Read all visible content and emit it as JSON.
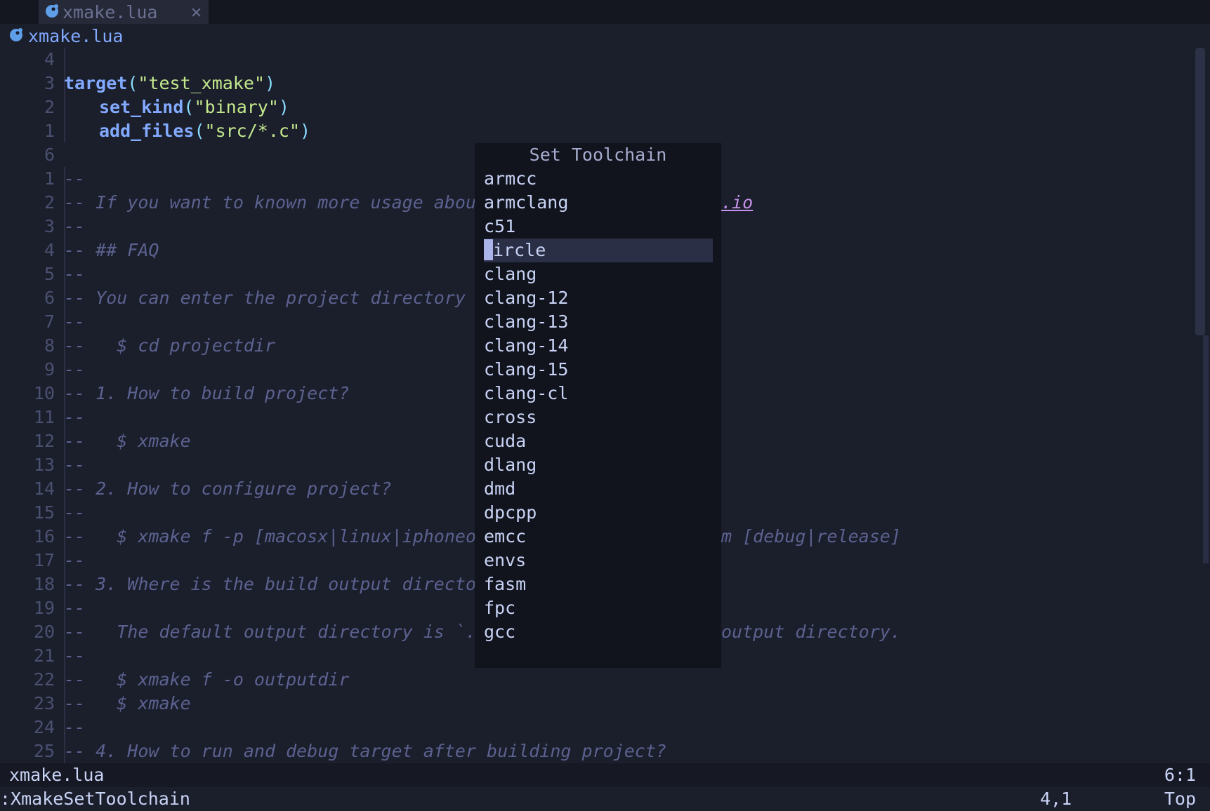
{
  "tabline": {
    "tab_label": "xmake.lua",
    "close_glyph": "✕"
  },
  "winbar": {
    "filename": "xmake.lua"
  },
  "code_lines": [
    {
      "num": "4",
      "text": ""
    },
    {
      "num": "3",
      "target": "target",
      "arg": "\"test_xmake\""
    },
    {
      "num": "2",
      "fn": "set_kind",
      "arg": "\"binary\""
    },
    {
      "num": "1",
      "fn": "add_files",
      "arg": "\"src/*.c\""
    },
    {
      "num": "6",
      "text": ""
    },
    {
      "num": "1",
      "comment": "--"
    },
    {
      "num": "2",
      "comment": "-- If you want to known more usage about xmak",
      "url": ".io"
    },
    {
      "num": "3",
      "comment": "--"
    },
    {
      "num": "4",
      "comment": "-- ## FAQ"
    },
    {
      "num": "5",
      "comment": "--"
    },
    {
      "num": "6",
      "comment": "-- You can enter the project directory firstl"
    },
    {
      "num": "7",
      "comment": "--"
    },
    {
      "num": "8",
      "comment": "--   $ cd projectdir"
    },
    {
      "num": "9",
      "comment": "--"
    },
    {
      "num": "10",
      "comment": "-- 1. How to build project?"
    },
    {
      "num": "11",
      "comment": "--"
    },
    {
      "num": "12",
      "comment": "--   $ xmake"
    },
    {
      "num": "13",
      "comment": "--"
    },
    {
      "num": "14",
      "comment": "-- 2. How to configure project?"
    },
    {
      "num": "15",
      "comment": "--"
    },
    {
      "num": "16",
      "comment": "--   $ xmake f -p [macosx|linux|iphoneos ..]",
      "tail": "m [debug|release]"
    },
    {
      "num": "17",
      "comment": "--"
    },
    {
      "num": "18",
      "comment": "-- 3. Where is the build output directory?"
    },
    {
      "num": "19",
      "comment": "--"
    },
    {
      "num": "20",
      "comment": "--   The default output directory is `./build",
      "tail": "output directory."
    },
    {
      "num": "21",
      "comment": "--"
    },
    {
      "num": "22",
      "comment": "--   $ xmake f -o outputdir"
    },
    {
      "num": "23",
      "comment": "--   $ xmake"
    },
    {
      "num": "24",
      "comment": "--"
    },
    {
      "num": "25",
      "comment": "-- 4. How to run and debug target after building project?"
    }
  ],
  "popup": {
    "title": "Set Toolchain",
    "items": [
      "armcc",
      "armclang",
      "c51",
      "ircle",
      "clang",
      "clang-12",
      "clang-13",
      "clang-14",
      "clang-15",
      "clang-cl",
      "cross",
      "cuda",
      "dlang",
      "dmd",
      "dpcpp",
      "emcc",
      "envs",
      "fasm",
      "fpc",
      "gcc"
    ],
    "selected_index": 3
  },
  "statusline": {
    "filename": "xmake.lua",
    "position": "6:1"
  },
  "cmdline": {
    "command": ":XmakeSetToolchain",
    "ruler": "4,1",
    "scroll": "Top"
  }
}
